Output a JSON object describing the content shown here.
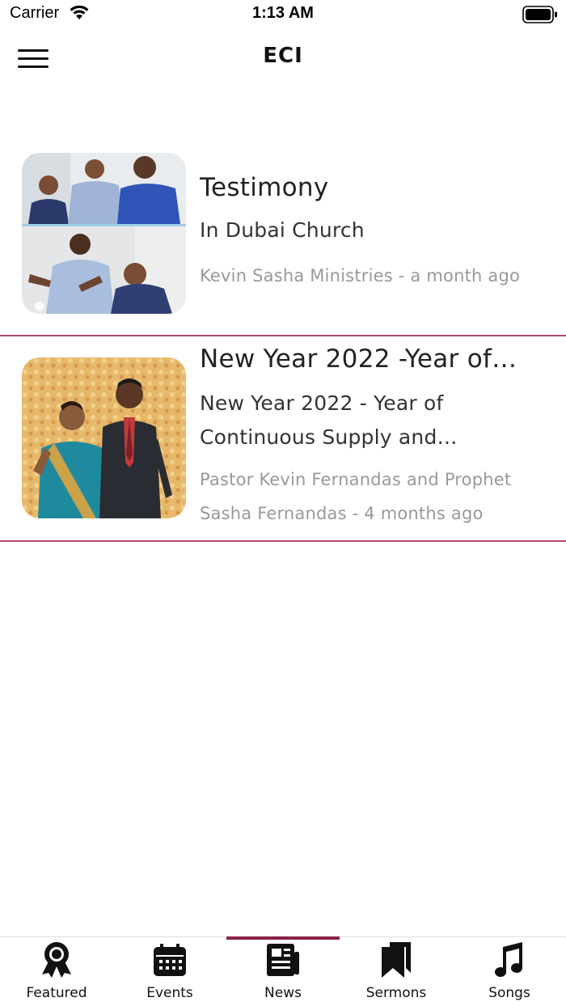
{
  "status_bar": {
    "carrier": "Carrier",
    "time": "1:13 AM"
  },
  "nav": {
    "title": "ECI"
  },
  "news": [
    {
      "title": "Testimony",
      "subtitle": "In Dubai Church",
      "meta_line1": "Kevin Sasha Ministries - a month ago",
      "meta_line2": ""
    },
    {
      "title": "New Year 2022 -Year of…",
      "subtitle": "New Year 2022 - Year of Continuous Supply and…",
      "meta_line1": "Pastor Kevin Fernandas and Prophet",
      "meta_line2": "Sasha Fernandas - 4 months ago"
    }
  ],
  "tabs": [
    {
      "label": "Featured",
      "icon": "award-icon"
    },
    {
      "label": "Events",
      "icon": "calendar-icon"
    },
    {
      "label": "News",
      "icon": "newspaper-icon"
    },
    {
      "label": "Sermons",
      "icon": "bookmarks-icon"
    },
    {
      "label": "Songs",
      "icon": "music-note-icon"
    }
  ],
  "active_tab": "News",
  "colors": {
    "accent": "#8a2146",
    "divider": "#b5496f",
    "meta_text": "#999999"
  }
}
